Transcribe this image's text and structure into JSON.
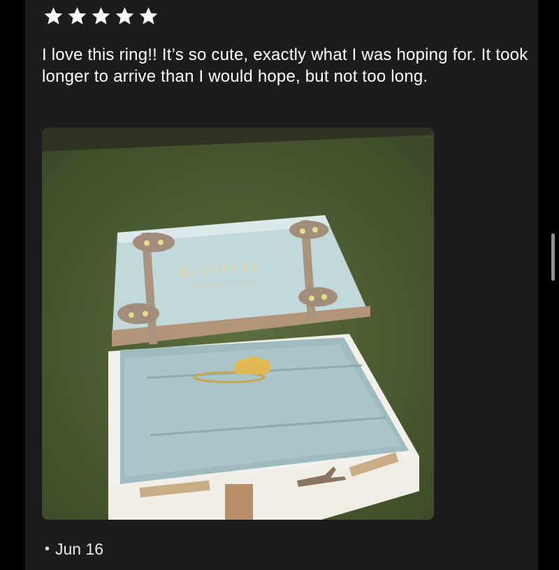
{
  "review": {
    "rating": 5,
    "rating_max": 5,
    "text": "I love this ring!! It’s so cute, exactly what I was hoping for. It took longer to arrive than I would hope, but not too long.",
    "date": "Jun 16",
    "bullet": "•"
  },
  "photo": {
    "box_brand": "BLOOBLEE",
    "box_tagline": "LITTLE DAINTY JEWELRY"
  },
  "colors": {
    "background": "#000000",
    "panel": "#1c1c1e",
    "star": "#ffffff",
    "text": "#ffffff"
  }
}
